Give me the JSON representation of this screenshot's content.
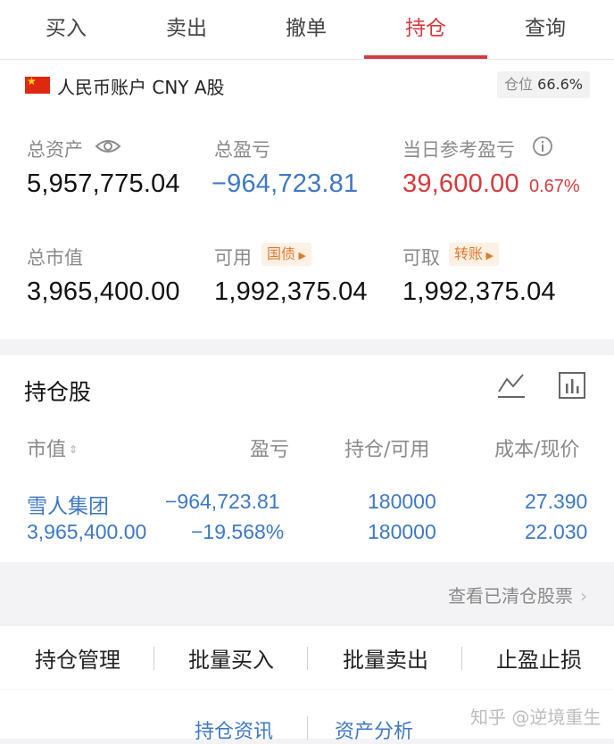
{
  "tabs": [
    "买入",
    "卖出",
    "撤单",
    "持仓",
    "查询"
  ],
  "active_tab": "持仓",
  "account": {
    "label": "人民币账户 CNY A股",
    "position_ratio_label": "仓位",
    "position_ratio_value": "66.6%"
  },
  "summary": {
    "total_assets_label": "总资产",
    "total_assets": "5,957,775.04",
    "total_pnl_label": "总盈亏",
    "total_pnl": "−964,723.81",
    "today_pnl_label": "当日参考盈亏",
    "today_pnl": "39,600.00",
    "today_pnl_pct": "0.67%",
    "market_value_label": "总市值",
    "market_value": "3,965,400.00",
    "available_label": "可用",
    "available_tag": "国债",
    "available": "1,992,375.04",
    "withdrawable_label": "可取",
    "withdrawable_tag": "转账",
    "withdrawable": "1,992,375.04"
  },
  "holdings": {
    "title": "持仓股",
    "headers": {
      "market_value": "市值",
      "pnl": "盈亏",
      "qty": "持仓/可用",
      "cost": "成本/现价"
    },
    "rows": [
      {
        "name": "雪人集团",
        "market_value": "3,965,400.00",
        "pnl": "−964,723.81",
        "pnl_pct": "−19.568%",
        "position": "180000",
        "available": "180000",
        "cost": "27.390",
        "price": "22.030"
      }
    ]
  },
  "cleared_link": "查看已清仓股票",
  "toolbar": [
    "持仓管理",
    "批量买入",
    "批量卖出",
    "止盈止损"
  ],
  "bottom_links": [
    "持仓资讯",
    "资产分析"
  ],
  "watermark": "知乎 @逆境重生",
  "colors": {
    "accent_red": "#d43a3f",
    "link_blue": "#3e78c6",
    "tag_orange": "#e07a2a"
  }
}
